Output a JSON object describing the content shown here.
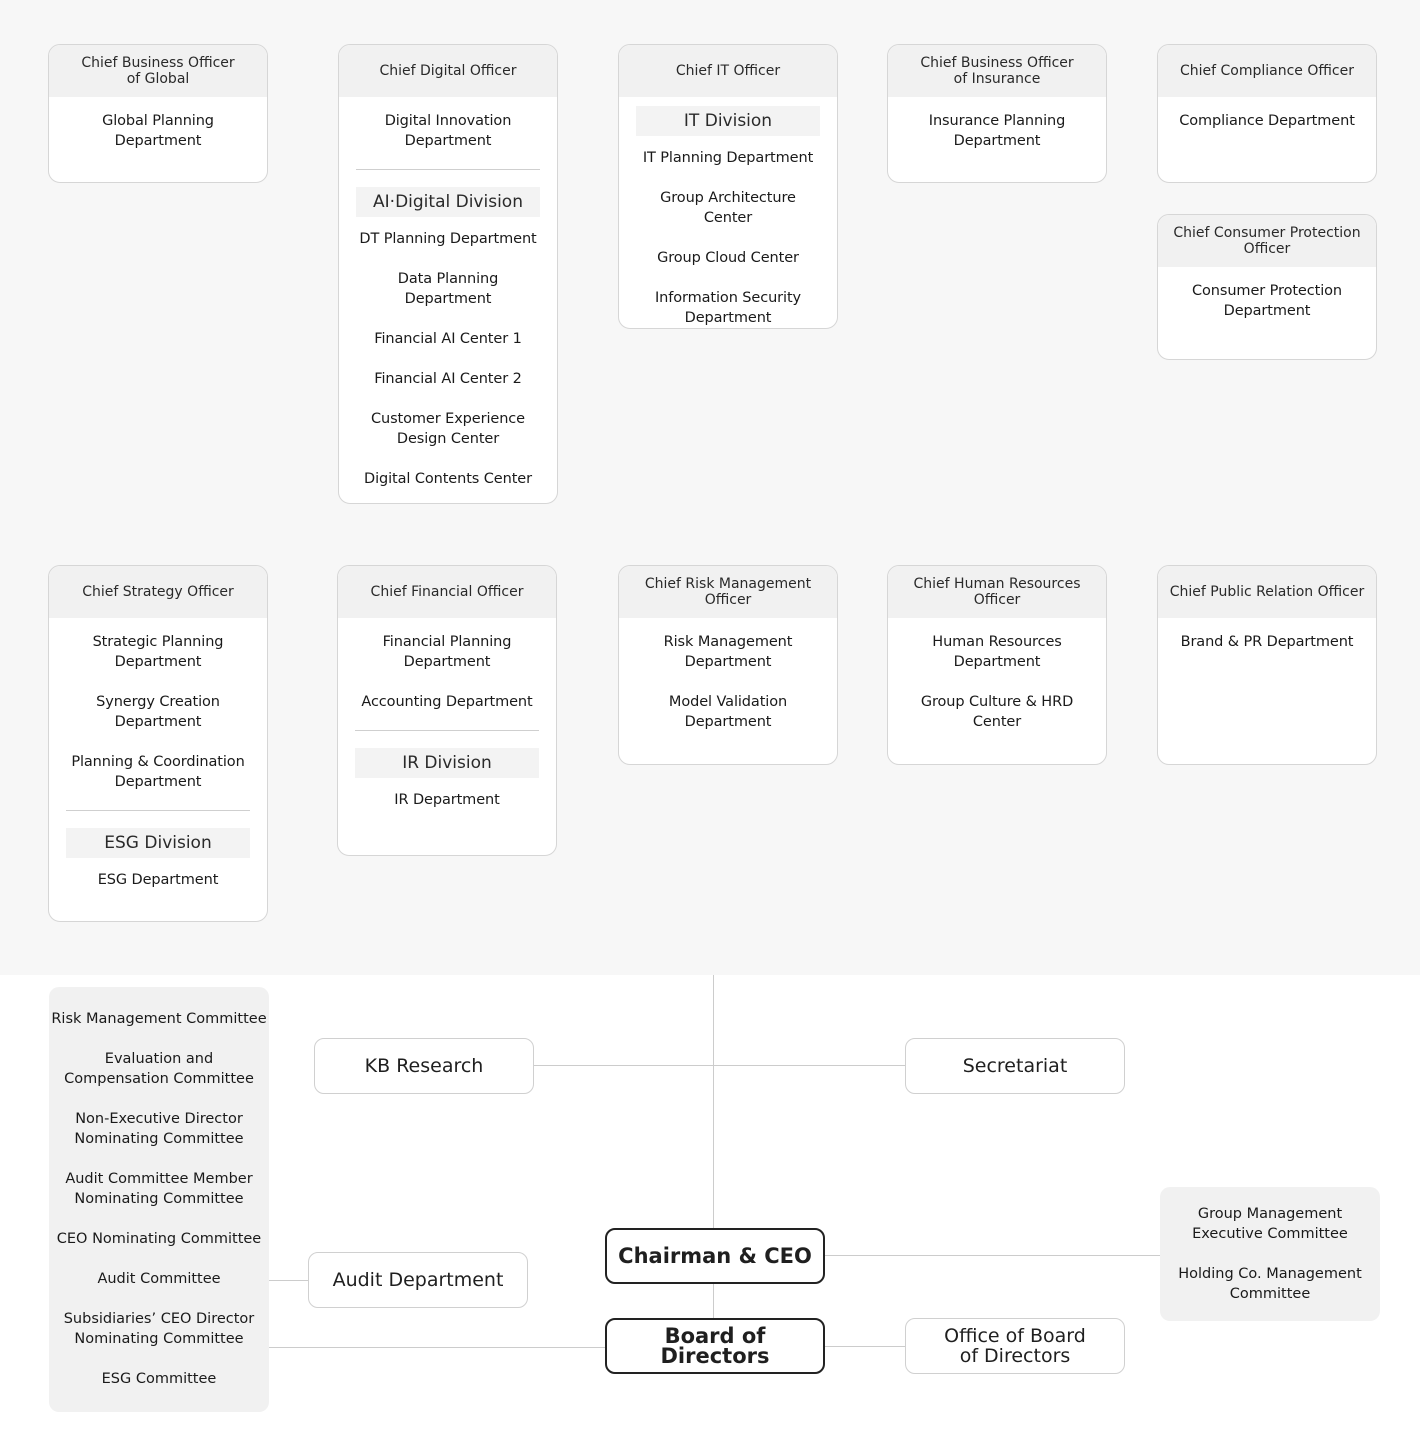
{
  "officers_row1": [
    {
      "title": "Chief Business Officer\nof Global",
      "items": [
        {
          "type": "dept",
          "label": "Global Planning Department"
        }
      ]
    },
    {
      "title": "Chief Digital Officer",
      "items": [
        {
          "type": "dept",
          "label": "Digital Innovation\nDepartment"
        },
        {
          "type": "divider"
        },
        {
          "type": "division",
          "label": "AI·Digital Division"
        },
        {
          "type": "dept",
          "label": "DT Planning Department"
        },
        {
          "type": "dept",
          "label": "Data Planning Department"
        },
        {
          "type": "dept",
          "label": "Financial AI Center 1"
        },
        {
          "type": "dept",
          "label": "Financial AI Center 2"
        },
        {
          "type": "dept",
          "label": "Customer Experience\nDesign Center"
        },
        {
          "type": "dept",
          "label": "Digital Contents Center"
        }
      ]
    },
    {
      "title": "Chief IT Officer",
      "items": [
        {
          "type": "division",
          "label": "IT Division"
        },
        {
          "type": "dept",
          "label": "IT Planning Department"
        },
        {
          "type": "dept",
          "label": "Group Architecture Center"
        },
        {
          "type": "dept",
          "label": "Group Cloud Center"
        },
        {
          "type": "dept",
          "label": "Information Security\nDepartment"
        }
      ]
    },
    {
      "title": "Chief Business Officer\nof Insurance",
      "items": [
        {
          "type": "dept",
          "label": "Insurance Planning\nDepartment"
        }
      ]
    },
    {
      "title": "Chief Compliance Officer",
      "items": [
        {
          "type": "dept",
          "label": "Compliance Department"
        }
      ]
    },
    {
      "title": "Chief Consumer Protection\nOfficer",
      "items": [
        {
          "type": "dept",
          "label": "Consumer Protection\nDepartment"
        }
      ]
    }
  ],
  "officers_row2": [
    {
      "title": "Chief Strategy Officer",
      "items": [
        {
          "type": "dept",
          "label": "Strategic Planning\nDepartment"
        },
        {
          "type": "dept",
          "label": "Synergy Creation\nDepartment"
        },
        {
          "type": "dept",
          "label": "Planning & Coordination\nDepartment"
        },
        {
          "type": "divider"
        },
        {
          "type": "division",
          "label": "ESG Division"
        },
        {
          "type": "dept",
          "label": "ESG Department"
        }
      ]
    },
    {
      "title": "Chief Financial Officer",
      "items": [
        {
          "type": "dept",
          "label": "Financial Planning\nDepartment"
        },
        {
          "type": "dept",
          "label": "Accounting Department"
        },
        {
          "type": "divider"
        },
        {
          "type": "division",
          "label": "IR Division"
        },
        {
          "type": "dept",
          "label": "IR Department"
        }
      ]
    },
    {
      "title": "Chief Risk Management Officer",
      "items": [
        {
          "type": "dept",
          "label": "Risk Management\nDepartment"
        },
        {
          "type": "dept",
          "label": "Model Validation\nDepartment"
        }
      ]
    },
    {
      "title": "Chief Human Resources Officer",
      "items": [
        {
          "type": "dept",
          "label": "Human Resources\nDepartment"
        },
        {
          "type": "dept",
          "label": "Group Culture & HRD Center"
        }
      ]
    },
    {
      "title": "Chief Public Relation Officer",
      "items": [
        {
          "type": "dept",
          "label": "Brand & PR Department"
        }
      ]
    }
  ],
  "board_committees": [
    "Risk Management Committee",
    "Evaluation and\nCompensation Committee",
    "Non-Executive Director\nNominating Committee",
    "Audit Committee Member\nNominating Committee",
    "CEO Nominating Committee",
    "Audit Committee",
    "Subsidiaries’ CEO Director\nNominating Committee",
    "ESG Committee"
  ],
  "management_committees": [
    "Group Management\nExecutive Committee",
    "Holding Co. Management\nCommittee"
  ],
  "nodes": {
    "kb_research": "KB Research",
    "secretariat": "Secretariat",
    "chairman_ceo": "Chairman & CEO",
    "board_of_directors": "Board of Directors",
    "audit_department": "Audit Department",
    "office_of_board": "Office of Board\nof Directors"
  },
  "colors": {
    "top_background": "#f7f7f7",
    "card_header": "#f1f1f1",
    "committee_background": "#f1f1f1",
    "connector_line": "#cccccc",
    "strong_border": "#222222"
  }
}
